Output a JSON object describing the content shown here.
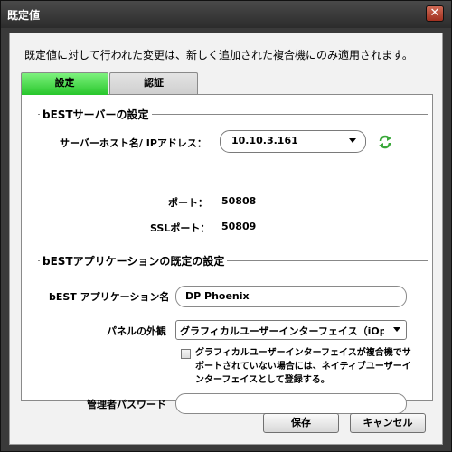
{
  "window": {
    "title": "既定値",
    "close_label": "✕"
  },
  "info_text": "既定値に対して行われた変更は、新しく追加された複合機にのみ適用されます。",
  "tabs": [
    {
      "label": "設定",
      "active": true
    },
    {
      "label": "認証",
      "active": false
    }
  ],
  "server_section": {
    "title": "bESTサーバーの設定",
    "host_label": "サーバーホスト名/ IPアドレス：",
    "host_value": "10.10.3.161",
    "port_label": "ポート：",
    "port_value": "50808",
    "ssl_label": "SSLポート：",
    "ssl_value": "50809"
  },
  "app_section": {
    "title": "bESTアプリケーションの既定の設定",
    "app_name_label": "bEST アプリケーション名",
    "app_name_value": "DP Phoenix",
    "appearance_label": "パネルの外観",
    "appearance_value": "グラフィカルユーザーインターフェイス（iOpt",
    "fallback_checkbox_label": "グラフィカルユーザーインターフェイスが複合機でサポートされていない場合には、ネイティブユーザーインターフェイスとして登録する。",
    "fallback_checked": false,
    "admin_password_label": "管理者パスワード",
    "admin_password_value": ""
  },
  "buttons": {
    "save": "保存",
    "cancel": "キャンセル"
  },
  "colors": {
    "active_tab": "#3ddc41",
    "refresh_icon": "#3aa83a"
  },
  "icons": {
    "refresh": "refresh-icon"
  }
}
